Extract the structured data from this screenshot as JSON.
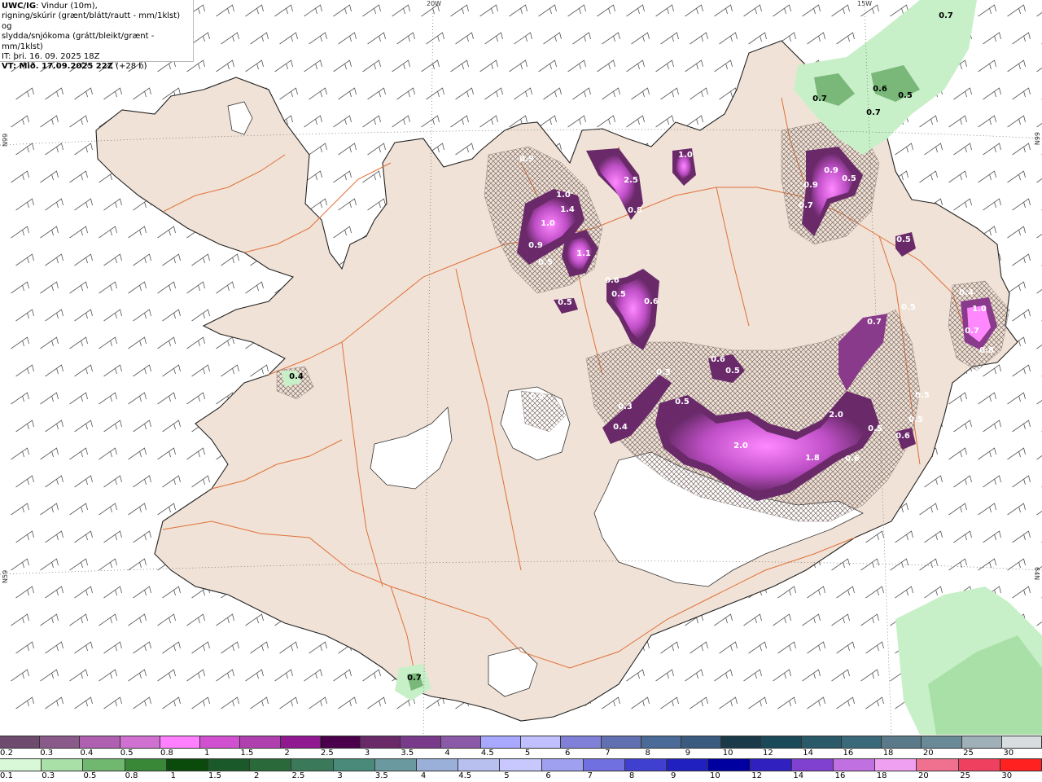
{
  "header": {
    "model": "UWC/IG",
    "line1_rest": ": Vindur (10m),",
    "line2": "rigning/skúrir (grænt/blátt/rautt - mm/1klst) og",
    "line3": "slydda/snjókoma (grátt/bleikt/grænt - mm/1klst)",
    "line4": "IT: þri. 16. 09. 2025 18Z",
    "line5_bold": "VT: Mið. 17.09.2025 22Z",
    "line5_rest": " (+28 h)"
  },
  "graticule": {
    "lon1": "20W",
    "lon2": "15W",
    "lat_left_top": "N99",
    "lat_left_bottom": "N59",
    "lat_right_top": "66N",
    "lat_right_bottom": "64N"
  },
  "colors": {
    "land": "#f0e2d6",
    "sea": "#ffffff",
    "roads": "#e0703a",
    "coast": "#222222"
  },
  "snow_labels": [
    "0.9",
    "1.0",
    "1.4",
    "1.0",
    "0.9",
    "0.5",
    "1.1",
    "0.5",
    "2.5",
    "0.8",
    "1.0",
    "0.6",
    "0.5",
    "0.6",
    "0.9",
    "0.5",
    "0.9",
    "0.7",
    "0.5",
    "0.5",
    "0.3",
    "0.3",
    "0.4",
    "0.5",
    "0.6",
    "0.5",
    "0.7",
    "2.0",
    "2.0",
    "1.8",
    "0.6",
    "0.5",
    "0.5",
    "0.6",
    "0.4",
    "1.0",
    "0.7",
    "0.8",
    "0.4",
    "0.2",
    "0.5"
  ],
  "rain_labels": [
    "0.7",
    "0.6",
    "0.7",
    "0.5",
    "0.7",
    "0.4",
    "0.7"
  ],
  "colorbar_snow": {
    "labels": [
      "0.2",
      "0.3",
      "0.4",
      "0.5",
      "0.8",
      "1",
      "1.5",
      "2",
      "2.5",
      "3",
      "3.5",
      "4",
      "4.5",
      "5",
      "6",
      "7",
      "8",
      "9",
      "10",
      "12",
      "14",
      "16",
      "18",
      "20",
      "25",
      "30"
    ],
    "colors": [
      "#6e4a6e",
      "#8a5a8a",
      "#b060b0",
      "#d070d0",
      "#ff80ff",
      "#d050d0",
      "#b040b0",
      "#901890",
      "#4a004a",
      "#6a2a6a",
      "#7a3a8a",
      "#8a5aa8",
      "#a8a8ff",
      "#c0c0ff",
      "#8080d8",
      "#6070b0",
      "#4a6a98",
      "#3a5a80",
      "#1a3a4a",
      "#1a4a5a",
      "#2a5a6a",
      "#3a6a7a",
      "#5a7a8a",
      "#6a8a98",
      "#a0b0b8",
      "#d8dde0"
    ]
  },
  "colorbar_rain": {
    "labels": [
      "0.1",
      "0.3",
      "0.5",
      "0.8",
      "1",
      "1.5",
      "2",
      "2.5",
      "3",
      "3.5",
      "4",
      "4.5",
      "5",
      "6",
      "7",
      "8",
      "9",
      "10",
      "12",
      "14",
      "16",
      "18",
      "20",
      "25",
      "30"
    ],
    "colors": [
      "#d8f8d8",
      "#a8e0a8",
      "#70b870",
      "#388838",
      "#0a4a0a",
      "#1a5a2a",
      "#2a6a3a",
      "#3a7a5a",
      "#4a8a7a",
      "#6a9aa0",
      "#9ab0d8",
      "#b8c0f0",
      "#c8c8ff",
      "#a0a0f0",
      "#7070e0",
      "#4040d0",
      "#2020c0",
      "#0000a0",
      "#3020c0",
      "#8040d0",
      "#c070e0",
      "#f0a0f0",
      "#f07090",
      "#f04060",
      "#ff2020"
    ]
  }
}
